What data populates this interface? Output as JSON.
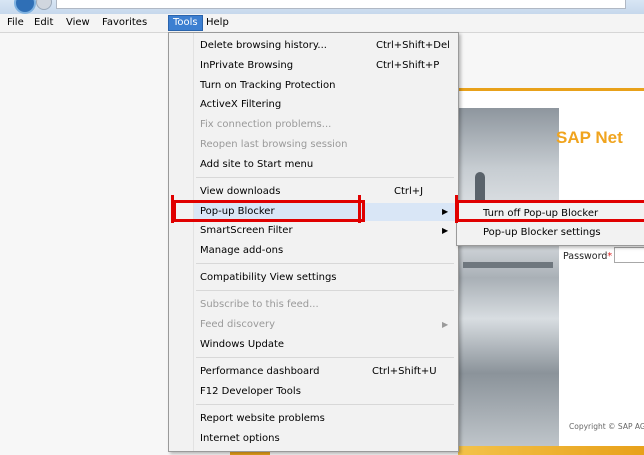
{
  "menubar": {
    "items": [
      "File",
      "Edit",
      "View",
      "Favorites",
      "Tools",
      "Help"
    ],
    "active_item": "Tools"
  },
  "tools_menu": {
    "items": [
      {
        "label": "Delete browsing history...",
        "shortcut": "Ctrl+Shift+Del",
        "enabled": true
      },
      {
        "label": "InPrivate Browsing",
        "shortcut": "Ctrl+Shift+P",
        "enabled": true
      },
      {
        "label": "Turn on Tracking Protection",
        "enabled": true
      },
      {
        "label": "ActiveX Filtering",
        "enabled": true
      },
      {
        "label": "Fix connection problems...",
        "enabled": false
      },
      {
        "label": "Reopen last browsing session",
        "enabled": false
      },
      {
        "label": "Add site to Start menu",
        "enabled": true
      },
      {
        "label": "View downloads",
        "shortcut": "Ctrl+J",
        "enabled": true
      },
      {
        "label": "Pop-up Blocker",
        "has_submenu": true,
        "enabled": true,
        "highlighted": true
      },
      {
        "label": "SmartScreen Filter",
        "has_submenu": true,
        "enabled": true
      },
      {
        "label": "Manage add-ons",
        "enabled": true
      },
      {
        "label": "Compatibility View settings",
        "enabled": true
      },
      {
        "label": "Subscribe to this feed...",
        "enabled": false
      },
      {
        "label": "Feed discovery",
        "has_submenu": true,
        "enabled": false
      },
      {
        "label": "Windows Update",
        "enabled": true
      },
      {
        "label": "Performance dashboard",
        "shortcut": "Ctrl+Shift+U",
        "enabled": true
      },
      {
        "label": "F12 Developer Tools",
        "enabled": true
      },
      {
        "label": "Report website problems",
        "enabled": true
      },
      {
        "label": "Internet options",
        "enabled": true
      }
    ]
  },
  "popup_submenu": {
    "items": [
      {
        "label": "Turn off Pop-up Blocker"
      },
      {
        "label": "Pop-up Blocker settings"
      }
    ]
  },
  "web_page": {
    "title": "SAP Net",
    "password_label": "Password",
    "required_mark": "*",
    "copyright": "Copyright © SAP AG"
  },
  "colors": {
    "menu_highlight": "#3c7fd1",
    "annotation_red": "#e00000",
    "sap_gold": "#f0a41e"
  },
  "icons": {
    "submenu_arrow": "chevron-right-icon",
    "browser_logo": "ie-logo-icon"
  }
}
